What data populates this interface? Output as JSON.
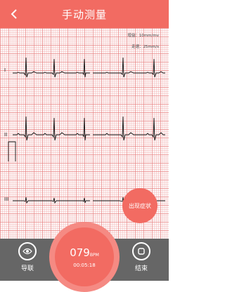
{
  "header": {
    "title": "手动测量",
    "back_icon": "chevron-left-icon"
  },
  "scale": {
    "amplitude": "增益：10mm/mv",
    "speed": "走速：25mm/s"
  },
  "leads": [
    "I",
    "II",
    "III"
  ],
  "symptom_button": {
    "label": "出现症状"
  },
  "bottom_bar": {
    "lead_button": {
      "label": "导联",
      "icon": "eye-icon"
    },
    "stop_button": {
      "label": "结束",
      "icon": "stop-icon"
    }
  },
  "timer": {
    "bpm": "079",
    "bpm_unit": "BPM",
    "elapsed": "00:05:18"
  },
  "colors": {
    "accent": "#f26b62",
    "grid": "#f2a8a8",
    "bar": "#666666"
  }
}
